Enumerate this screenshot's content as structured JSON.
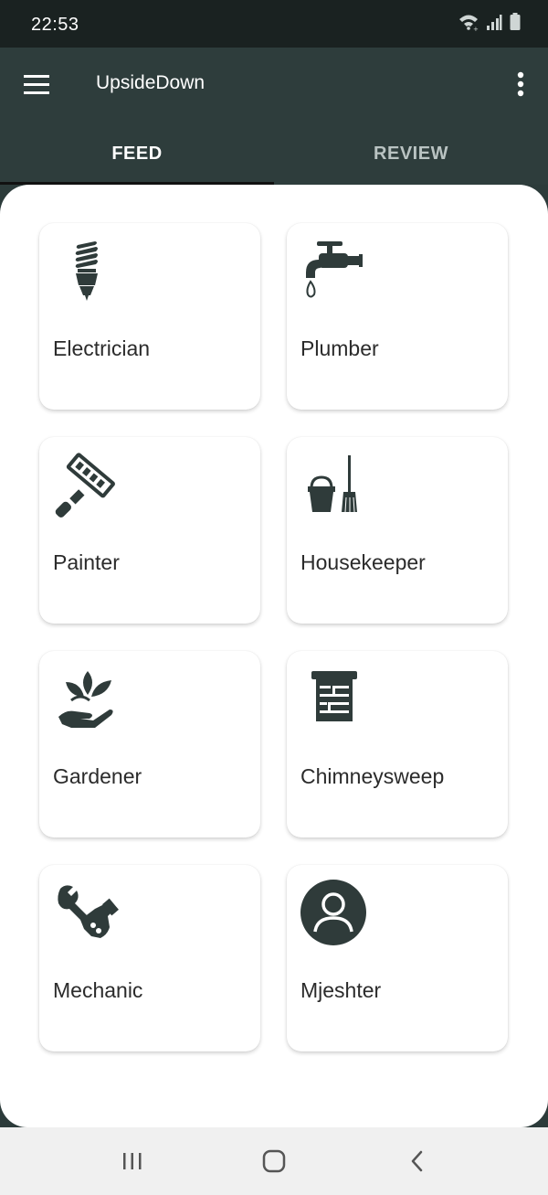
{
  "status_bar": {
    "time": "22:53",
    "icons": [
      "wifi-icon",
      "signal-icon",
      "battery-icon"
    ]
  },
  "app_bar": {
    "title": "UpsideDown",
    "menu_icon": "hamburger-menu-icon",
    "overflow_icon": "more-vert-icon"
  },
  "tabs": [
    {
      "label": "FEED",
      "selected": true
    },
    {
      "label": "REVIEW",
      "selected": false
    }
  ],
  "categories": [
    {
      "label": "Electrician",
      "icon": "lightbulb-icon"
    },
    {
      "label": "Plumber",
      "icon": "faucet-icon"
    },
    {
      "label": "Painter",
      "icon": "paint-roller-icon"
    },
    {
      "label": "Housekeeper",
      "icon": "bucket-broom-icon"
    },
    {
      "label": "Gardener",
      "icon": "plant-hand-icon"
    },
    {
      "label": "Chimneysweep",
      "icon": "chimney-icon"
    },
    {
      "label": "Mechanic",
      "icon": "wrench-hand-icon"
    },
    {
      "label": "Mjeshter",
      "icon": "user-avatar-icon"
    }
  ],
  "nav_bar": {
    "buttons": [
      "recent-apps-icon",
      "home-icon",
      "back-icon"
    ]
  },
  "colors": {
    "app_bar": "#2e3d3c",
    "status_bar": "#1a2221",
    "icon": "#2f3b3a",
    "card_bg": "#ffffff"
  }
}
